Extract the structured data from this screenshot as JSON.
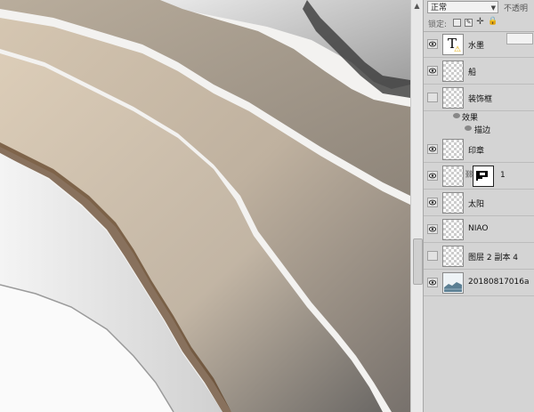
{
  "layers_panel": {
    "blend_mode": "正常",
    "opacity_label": "不透明",
    "lock_label": "锁定:",
    "lock_icons": [
      "lock-transparent-icon",
      "lock-paint-icon",
      "lock-move-icon",
      "lock-all-icon"
    ],
    "layers": [
      {
        "name": "水墨",
        "visible": true,
        "type": "text"
      },
      {
        "name": "船",
        "visible": true,
        "type": "normal"
      },
      {
        "name": "装饰框",
        "visible": false,
        "type": "normal"
      },
      {
        "name": "印章",
        "visible": true,
        "type": "normal"
      },
      {
        "name": "1",
        "visible": true,
        "type": "masked"
      },
      {
        "name": "太阳",
        "visible": true,
        "type": "normal"
      },
      {
        "name": "NIAO",
        "visible": true,
        "type": "normal"
      },
      {
        "name": "图层 2 副本 4",
        "visible": false,
        "type": "normal"
      },
      {
        "name": "20180817016a",
        "visible": true,
        "type": "image"
      }
    ],
    "effects": {
      "label": "效果",
      "stroke": "描边"
    }
  },
  "colors": {
    "panel_bg": "#d4d4d4",
    "canvas_bg": "#f3f2f0"
  }
}
